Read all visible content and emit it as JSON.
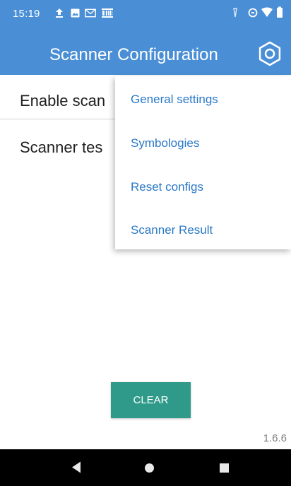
{
  "status_bar": {
    "time": "15:19",
    "notification_icons": [
      "upload-icon",
      "image-icon",
      "gmail-icon",
      "barcode-icon"
    ],
    "system_icons": [
      "alarm-icon",
      "data-saver-icon",
      "wifi-icon",
      "battery-icon"
    ]
  },
  "app_bar": {
    "title": "Scanner Configuration",
    "settings_icon": "gear-icon",
    "color": "#4a8fd6"
  },
  "main": {
    "enable_scanner_label": "Enable scan",
    "scanner_test_label": "Scanner tes"
  },
  "overflow_menu": {
    "items": [
      {
        "label": "General settings"
      },
      {
        "label": "Symbologies"
      },
      {
        "label": "Reset configs"
      },
      {
        "label": "Scanner Result"
      }
    ],
    "text_color": "#2a78c7"
  },
  "clear_button": {
    "label": "CLEAR",
    "color": "#2f9a8a"
  },
  "version": "1.6.6",
  "nav_bar": {
    "icons": [
      "back-icon",
      "home-icon",
      "recents-icon"
    ]
  }
}
